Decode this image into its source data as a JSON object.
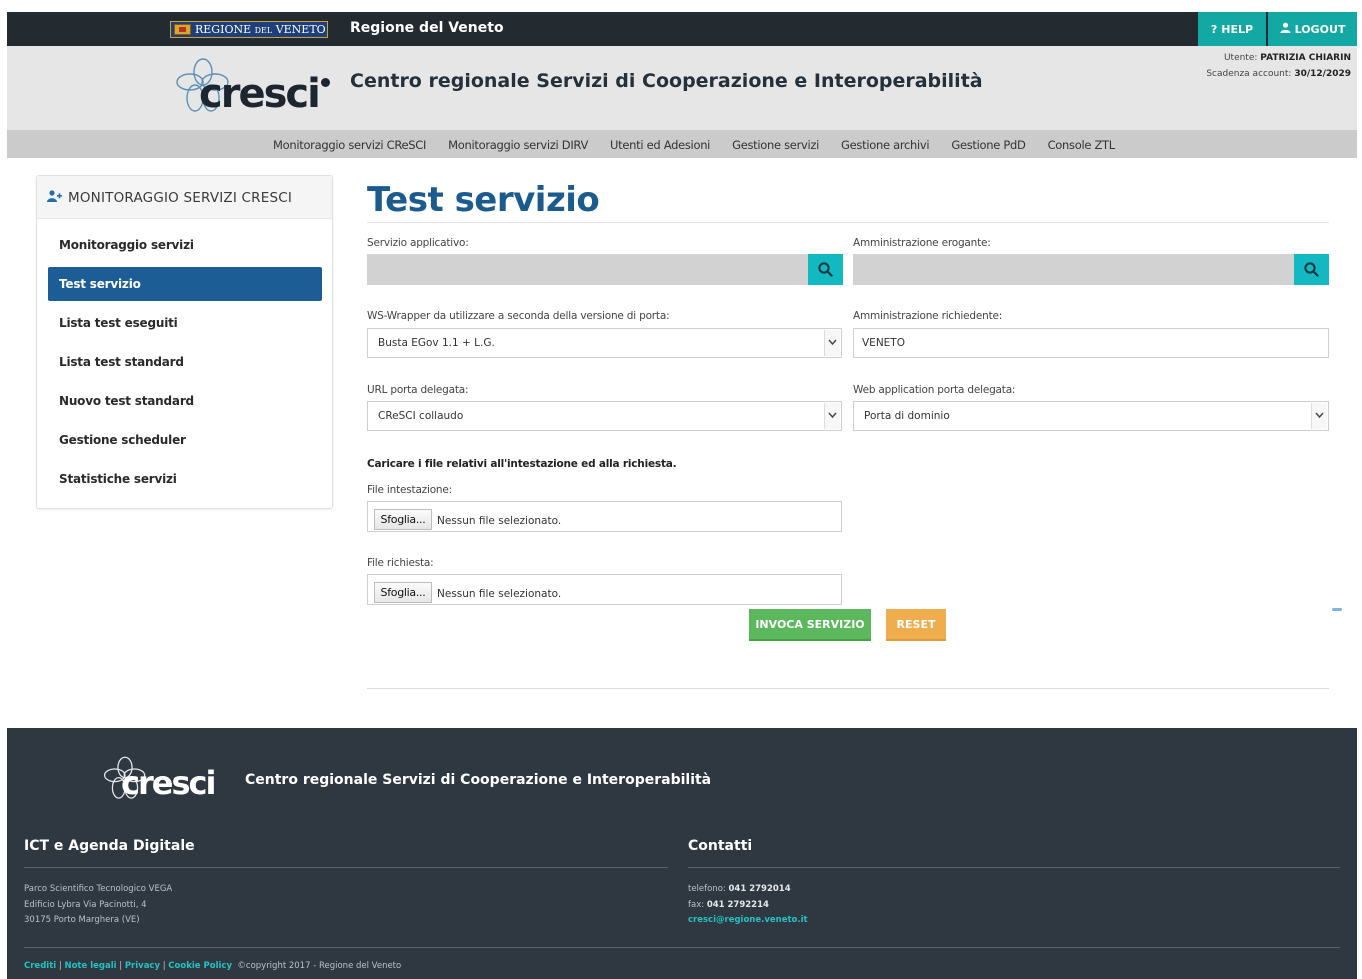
{
  "topbar": {
    "region_logo": {
      "main_left": "REGIONE",
      "small": "DEL",
      "main_right": "VENETO"
    },
    "title": "Regione del Veneto",
    "help_label": "HELP",
    "logout_label": "LOGOUT"
  },
  "header": {
    "logo_text": "cresci",
    "title": "Centro regionale Servizi di Cooperazione e Interoperabilità",
    "user_label": "Utente:",
    "user_name": "PATRIZIA CHIARIN",
    "expiry_label": "Scadenza account:",
    "expiry_date": "30/12/2029"
  },
  "nav": {
    "items": [
      {
        "label": "Monitoraggio servizi CReSCI"
      },
      {
        "label": "Monitoraggio servizi DIRV"
      },
      {
        "label": "Utenti ed Adesioni"
      },
      {
        "label": "Gestione servizi"
      },
      {
        "label": "Gestione archivi"
      },
      {
        "label": "Gestione PdD"
      },
      {
        "label": "Console ZTL"
      }
    ]
  },
  "sidebar": {
    "heading": "MONITORAGGIO SERVIZI CRESCI",
    "items": [
      {
        "label": "Monitoraggio servizi",
        "active": false
      },
      {
        "label": "Test servizio",
        "active": true
      },
      {
        "label": "Lista test eseguiti",
        "active": false
      },
      {
        "label": "Lista test standard",
        "active": false
      },
      {
        "label": "Nuovo test standard",
        "active": false
      },
      {
        "label": "Gestione scheduler",
        "active": false
      },
      {
        "label": "Statistiche servizi",
        "active": false
      }
    ]
  },
  "main": {
    "title": "Test servizio",
    "servizio_label": "Servizio applicativo:",
    "servizio_value": "",
    "erogante_label": "Amministrazione erogante:",
    "erogante_value": "",
    "wrapper_label": "WS-Wrapper da utilizzare a seconda della versione di porta:",
    "wrapper_value": "Busta EGov 1.1 + L.G.",
    "richiedente_label": "Amministrazione richiedente:",
    "richiedente_value": "VENETO",
    "url_label": "URL porta delegata:",
    "url_value": "CReSCI collaudo",
    "webapp_label": "Web application porta delegata:",
    "webapp_value": "Porta di dominio",
    "upload_note": "Caricare i file relativi all'intestazione ed alla richiesta.",
    "file_intestazione_label": "File intestazione:",
    "file_richiesta_label": "File richiesta:",
    "browse_label": "Sfoglia...",
    "no_file_label": "Nessun file selezionato.",
    "invoke_label": "INVOCA SERVIZIO",
    "reset_label": "RESET"
  },
  "footer": {
    "logo_text": "cresci",
    "title": "Centro regionale Servizi di Cooperazione e Interoperabilità",
    "left_heading": "ICT e Agenda Digitale",
    "address_lines": [
      "Parco Scientifico Tecnologico VEGA",
      "Edificio Lybra Via Pacinotti, 4",
      "30175 Porto Marghera (VE)"
    ],
    "right_heading": "Contatti",
    "phone_label": "telefono:",
    "phone": "041 2792014",
    "fax_label": "fax:",
    "fax": "041 2792214",
    "email": "cresci@regione.veneto.it",
    "links": [
      "Crediti",
      "Note legali",
      "Privacy",
      "Cookie Policy"
    ],
    "copyright": "©copyright 2017 - Regione del Veneto"
  },
  "colors": {
    "topbar": "#232a30",
    "accent_teal": "#13a8a4",
    "active_blue": "#1c5d96",
    "title_blue": "#1b5b8d",
    "invoke_green": "#5cb85c",
    "reset_orange": "#f0ad4e",
    "footer_bg": "#2f3840"
  },
  "icons": [
    "help-icon",
    "user-icon",
    "user-plus-icon",
    "search-icon",
    "chevron-down-icon"
  ]
}
